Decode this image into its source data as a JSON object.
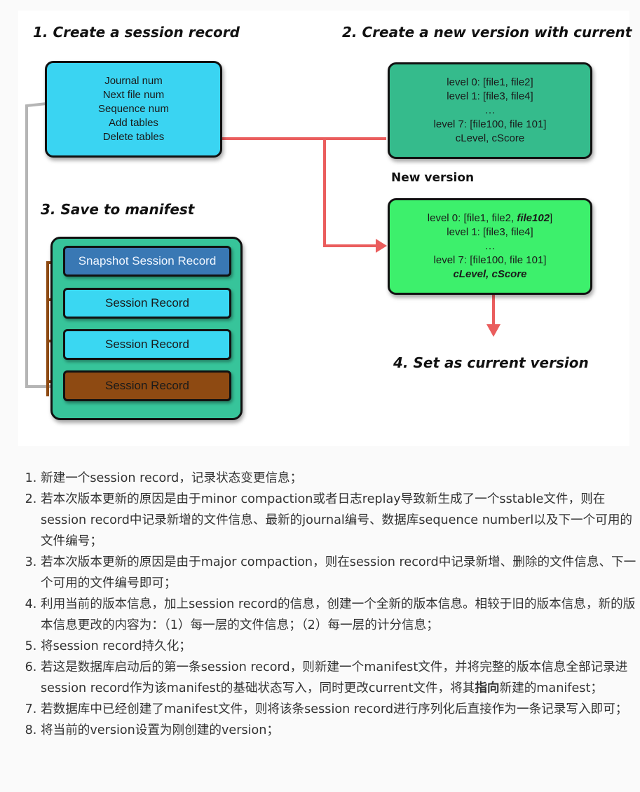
{
  "diagram": {
    "step1": "1. Create a session record",
    "step2": "2. Create a new version with current",
    "step3": "3. Save to manifest",
    "step4": "4. Set as current version",
    "new_version_label": "New version",
    "session_record_box": [
      "Journal num",
      "Next file num",
      "Sequence num",
      "Add tables",
      "Delete tables"
    ],
    "current_version_box": [
      "level 0: [file1, file2]",
      "level 1: [file3, file4]",
      "…",
      "level 7: [file100, file 101]",
      "cLevel, cScore"
    ],
    "new_version_box": {
      "line1_prefix": "level 0: [file1, file2, ",
      "line1_emph": "file102",
      "line1_suffix": "]",
      "line2": "level 1: [file3, file4]",
      "line3": "…",
      "line4": "level 7: [file100, file 101]",
      "line5": "cLevel, cScore"
    },
    "manifest_records": [
      "Snapshot Session Record",
      "Session Record",
      "Session Record",
      "Session Record"
    ],
    "colors": {
      "session_box": "#3ad4f2",
      "current_box": "#35bb8c",
      "new_box": "#3df06c",
      "manifest_bg": "#37c49a",
      "snapshot_record": "#3978b4",
      "record": "#3ad7f2",
      "last_record": "#8e4a12",
      "red_arrow": "#ea5d5d",
      "gray_arrow": "#b5b5b5",
      "brown_arrow": "#8e4a12"
    }
  },
  "steps": [
    "新建一个session record，记录状态变更信息；",
    "若本次版本更新的原因是由于minor compaction或者日志replay导致新生成了一个sstable文件，则在session record中记录新增的文件信息、最新的journal编号、数据库sequence numberl以及下一个可用的文件编号；",
    "若本次版本更新的原因是由于major compaction，则在session record中记录新增、删除的文件信息、下一个可用的文件编号即可；",
    "利用当前的版本信息，加上session record的信息，创建一个全新的版本信息。相较于旧的版本信息，新的版本信息更改的内容为：（1）每一层的文件信息；（2）每一层的计分信息；",
    "将session record持久化；",
    {
      "before": "若这是数据库启动后的第一条session record，则新建一个manifest文件，并将完整的版本信息全部记录进session record作为该manifest的基础状态写入，同时更改current文件，将其",
      "bold": "指向",
      "after": "新建的manifest；"
    },
    "若数据库中已经创建了manifest文件，则将该条session record进行序列化后直接作为一条记录写入即可；",
    "将当前的version设置为刚创建的version；"
  ]
}
